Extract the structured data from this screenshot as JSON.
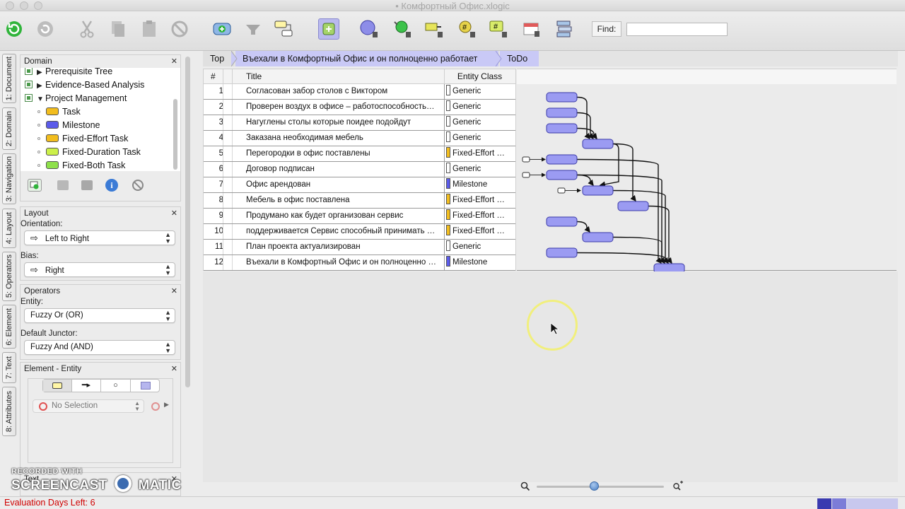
{
  "window": {
    "title": "• Комфортный Офис.xlogic"
  },
  "toolbar": {
    "find_label": "Find:",
    "find_value": "",
    "icons": [
      "refresh-green-icon",
      "reload-icon",
      "cut-icon",
      "copy-icon",
      "paste-icon",
      "cancel-icon",
      "add-entity-icon",
      "filter-icon",
      "layout-icon",
      "add-square-icon",
      "sphere-icon",
      "node-green-icon",
      "arrow-node-icon",
      "hash-yellow-icon",
      "hash-green-icon",
      "calendar-icon",
      "stack-icon"
    ]
  },
  "vertical_tabs": [
    "1: Document",
    "2: Domain",
    "3: Navigation",
    "4: Layout",
    "5: Operators",
    "6: Element",
    "7: Text",
    "8: Attributes"
  ],
  "domain_panel": {
    "title": "Domain",
    "items": [
      {
        "label": "Prerequisite Tree",
        "kind": "group",
        "color": ""
      },
      {
        "label": "Evidence-Based Analysis",
        "kind": "group",
        "color": ""
      },
      {
        "label": "Project Management",
        "kind": "group-open",
        "color": ""
      },
      {
        "label": "Task",
        "kind": "leaf",
        "color": "#f2bd1e"
      },
      {
        "label": "Milestone",
        "kind": "leaf",
        "color": "#5b5bea"
      },
      {
        "label": "Fixed-Effort Task",
        "kind": "leaf",
        "color": "#f2bd1e"
      },
      {
        "label": "Fixed-Duration Task",
        "kind": "leaf",
        "color": "#ccf04a"
      },
      {
        "label": "Fixed-Both Task",
        "kind": "leaf",
        "color": "#8ee04a"
      }
    ]
  },
  "layout_panel": {
    "title": "Layout",
    "orientation_label": "Orientation:",
    "orientation_value": "Left to Right",
    "bias_label": "Bias:",
    "bias_value": "Right"
  },
  "operators_panel": {
    "title": "Operators",
    "entity_label": "Entity:",
    "entity_value": "Fuzzy Or (OR)",
    "junctor_label": "Default Junctor:",
    "junctor_value": "Fuzzy And (AND)"
  },
  "element_panel": {
    "title": "Element - Entity",
    "selection_value": "No Selection"
  },
  "text_panel": {
    "title": "Text"
  },
  "breadcrumb": {
    "top": "Top",
    "middle": "Въехали в Комфортный Офис и он полноценно работает",
    "current": "ToDo"
  },
  "table": {
    "headers": {
      "num": "#",
      "title": "Title",
      "entity_class": "Entity Class"
    },
    "rows": [
      {
        "num": "1",
        "title": "Согласован забор столов с Виктором",
        "cls": "Generic",
        "color": "#ffffff"
      },
      {
        "num": "2",
        "title": "Проверен воздух в офисе – работоспособность…",
        "cls": "Generic",
        "color": "#ffffff"
      },
      {
        "num": "3",
        "title": "Нагуглены столы которые поидее подойдут",
        "cls": "Generic",
        "color": "#ffffff"
      },
      {
        "num": "4",
        "title": "Заказана необходимая мебель",
        "cls": "Generic",
        "color": "#ffffff"
      },
      {
        "num": "5",
        "title": "Перегородки в офис поставлены",
        "cls": "Fixed-Effort …",
        "color": "#f2bd1e"
      },
      {
        "num": "6",
        "title": "Договор подписан",
        "cls": "Generic",
        "color": "#ffffff"
      },
      {
        "num": "7",
        "title": "Офис арендован",
        "cls": "Milestone",
        "color": "#5b5bea"
      },
      {
        "num": "8",
        "title": "Мебель в офис поставлена",
        "cls": "Fixed-Effort …",
        "color": "#f2bd1e"
      },
      {
        "num": "9",
        "title": "Продумано как будет организован сервис",
        "cls": "Fixed-Effort …",
        "color": "#f2bd1e"
      },
      {
        "num": "10",
        "title": "поддерживается Сервис способный принимать …",
        "cls": "Fixed-Effort …",
        "color": "#f2bd1e"
      },
      {
        "num": "11",
        "title": "План проекта актуализирован",
        "cls": "Generic",
        "color": "#ffffff"
      },
      {
        "num": "12",
        "title": "Въехали в Комфортный Офис и он полноценно …",
        "cls": "Milestone",
        "color": "#5b5bea"
      }
    ]
  },
  "status": {
    "evaluation": "Evaluation Days Left: 6"
  },
  "watermark": {
    "line1": "RECORDED WITH",
    "line2": "SCREENCAST",
    "line3": "MATIC"
  },
  "colors": {
    "node_fill": "#9b9bf2",
    "node_stroke": "#3a3aa8",
    "breadcrumb_active": "#c9c9f6",
    "eval_text": "#d00000"
  }
}
